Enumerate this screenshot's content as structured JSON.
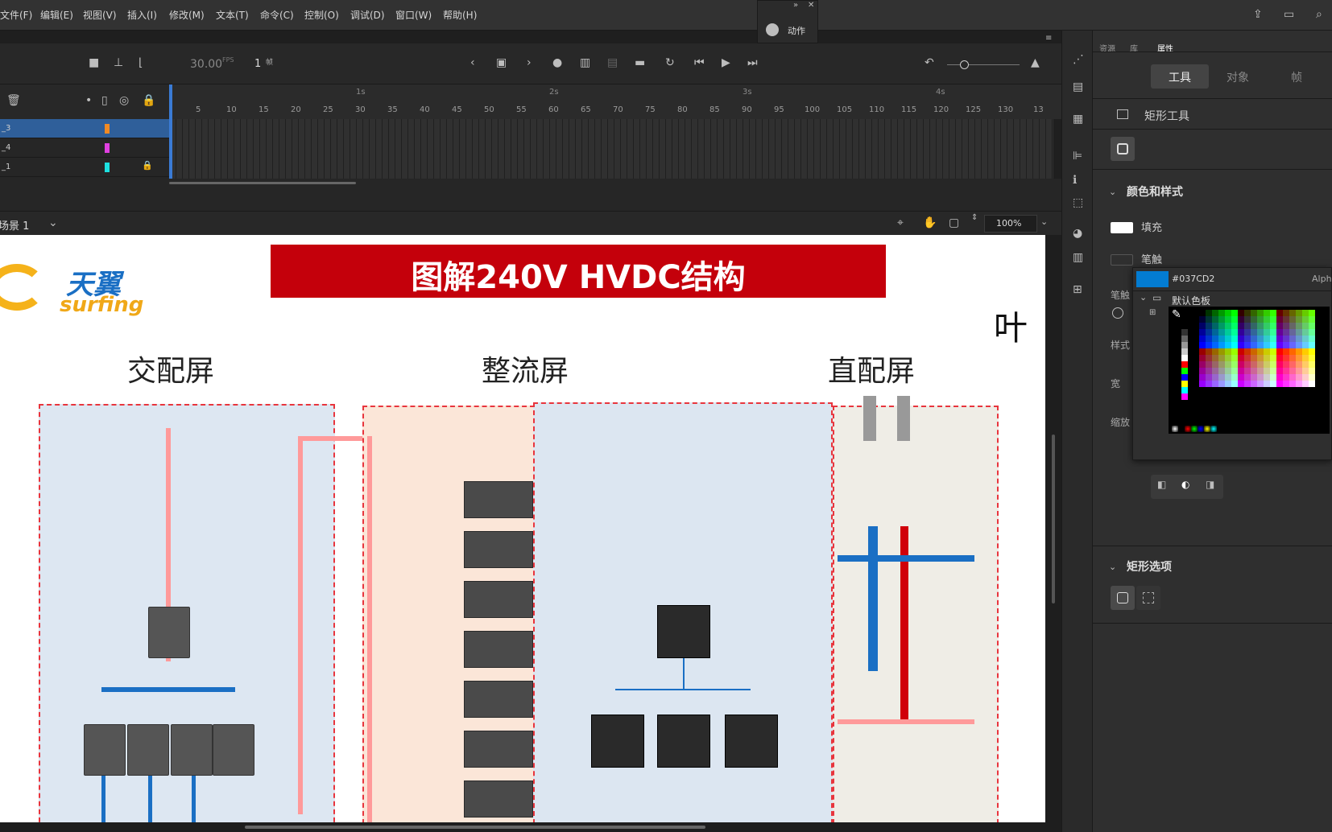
{
  "menu": [
    "文件(F)",
    "编辑(E)",
    "视图(V)",
    "插入(I)",
    "修改(M)",
    "文本(T)",
    "命令(C)",
    "控制(O)",
    "调试(D)",
    "窗口(W)",
    "帮助(H)"
  ],
  "actions_panel": {
    "label": "动作"
  },
  "timeline": {
    "fps": "30.00",
    "fps_unit": "FPS",
    "frame": "1",
    "frame_unit": "帧",
    "ticks": [
      "5",
      "10",
      "15",
      "20",
      "25",
      "30",
      "35",
      "40",
      "45",
      "50",
      "55",
      "60",
      "65",
      "70",
      "75",
      "80",
      "85",
      "90",
      "95",
      "100",
      "105",
      "110",
      "115",
      "120",
      "125",
      "130",
      "13"
    ],
    "seconds": [
      "1s",
      "2s",
      "3s",
      "4s"
    ],
    "layers": [
      {
        "name": "_3",
        "color": "#f08a24",
        "locked": false
      },
      {
        "name": "_4",
        "color": "#e040e0",
        "locked": false
      },
      {
        "name": "_1",
        "color": "#1de0e0",
        "locked": true
      }
    ]
  },
  "scene": {
    "label": "场景 1",
    "zoom": "100%"
  },
  "slide": {
    "logo_cn": "天翼",
    "logo_en": "surfing",
    "title": "图解240V HVDC结构",
    "col_ac": "交配屏",
    "col_rect": "整流屏",
    "col_dc": "直配屏",
    "edge_text": "叶"
  },
  "right_tabs": [
    "资源",
    "库",
    "属性"
  ],
  "props": {
    "subtabs": [
      "工具",
      "对象",
      "帧"
    ],
    "tool_name": "矩形工具",
    "section_color": "颜色和样式",
    "fill_label": "填充",
    "stroke_label": "笔触",
    "stroke_short": "笔触",
    "style_label": "样式",
    "width_label": "宽",
    "scale_label": "缩放",
    "section_rect": "矩形选项"
  },
  "color_picker": {
    "hex": "#037CD2",
    "alpha_label": "Alph",
    "palette_label": "默认色板",
    "current_color": "#037CD2"
  }
}
